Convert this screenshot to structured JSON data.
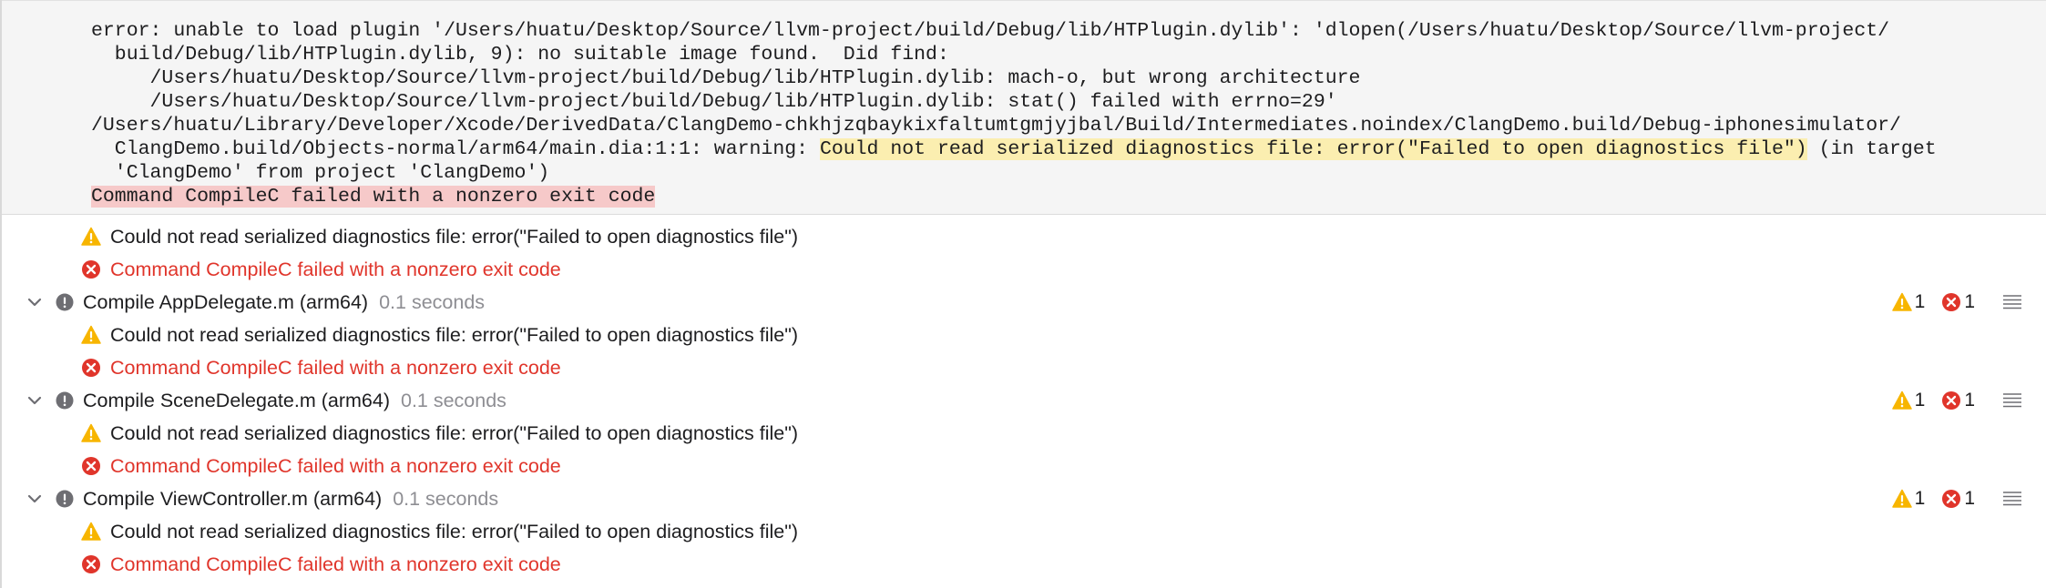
{
  "log": {
    "lines": [
      "error: unable to load plugin '/Users/huatu/Desktop/Source/llvm-project/build/Debug/lib/HTPlugin.dylib': 'dlopen(/Users/huatu/Desktop/Source/llvm-project/",
      "  build/Debug/lib/HTPlugin.dylib, 9): no suitable image found.  Did find:",
      "     /Users/huatu/Desktop/Source/llvm-project/build/Debug/lib/HTPlugin.dylib: mach-o, but wrong architecture",
      "     /Users/huatu/Desktop/Source/llvm-project/build/Debug/lib/HTPlugin.dylib: stat() failed with errno=29'",
      "/Users/huatu/Library/Developer/Xcode/DerivedData/ClangDemo-chkhjzqbaykixfaltumtgmjyjbal/Build/Intermediates.noindex/ClangDemo.build/Debug-iphonesimulator/"
    ],
    "line6_prefix": "  ClangDemo.build/Objects-normal/arm64/main.dia:1:1: warning: ",
    "line6_highlight": "Could not read serialized diagnostics file: error(\"Failed to open diagnostics file\")",
    "line6_suffix": " (in target",
    "line7": "  'ClangDemo' from project 'ClangDemo')",
    "error_line": "Command CompileC failed with a nonzero exit code"
  },
  "top_messages": {
    "warning": "Could not read serialized diagnostics file: error(\"Failed to open diagnostics file\")",
    "error": "Command CompileC failed with a nonzero exit code"
  },
  "groups": [
    {
      "title": "Compile AppDelegate.m (arm64)",
      "duration": "0.1 seconds",
      "warning_count": "1",
      "error_count": "1",
      "warning": "Could not read serialized diagnostics file: error(\"Failed to open diagnostics file\")",
      "error": "Command CompileC failed with a nonzero exit code"
    },
    {
      "title": "Compile SceneDelegate.m (arm64)",
      "duration": "0.1 seconds",
      "warning_count": "1",
      "error_count": "1",
      "warning": "Could not read serialized diagnostics file: error(\"Failed to open diagnostics file\")",
      "error": "Command CompileC failed with a nonzero exit code"
    },
    {
      "title": "Compile ViewController.m (arm64)",
      "duration": "0.1 seconds",
      "warning_count": "1",
      "error_count": "1",
      "warning": "Could not read serialized diagnostics file: error(\"Failed to open diagnostics file\")",
      "error": "Command CompileC failed with a nonzero exit code"
    }
  ],
  "icons": {
    "warning": "warning-triangle-icon",
    "error": "error-x-circle-icon",
    "group_status": "exclamation-circle-icon",
    "disclosure": "chevron-down-icon",
    "details": "list-lines-icon"
  },
  "colors": {
    "warning_yellow": "#f7b500",
    "error_red": "#e0352b",
    "warning_highlight": "#fbeeb0",
    "error_highlight": "#f6c9c9",
    "log_background": "#f5f5f5"
  }
}
